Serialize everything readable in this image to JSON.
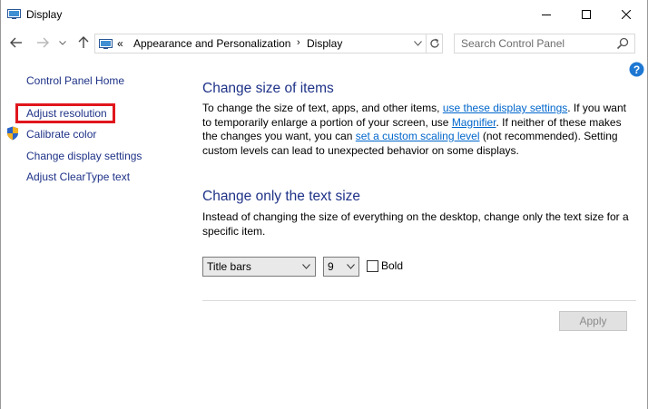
{
  "window": {
    "title": "Display",
    "controls": [
      "minimize",
      "maximize",
      "close"
    ]
  },
  "address_bar": {
    "prefix": "«",
    "breadcrumbs": [
      "Appearance and Personalization",
      "Display"
    ],
    "separator": "›"
  },
  "search": {
    "placeholder": "Search Control Panel"
  },
  "sidebar": {
    "home_link": "Control Panel Home",
    "links": [
      {
        "label": "Adjust resolution",
        "highlighted": true
      },
      {
        "label": "Calibrate color",
        "icon": "shield-icon"
      },
      {
        "label": "Change display settings"
      },
      {
        "label": "Adjust ClearType text"
      }
    ]
  },
  "section1": {
    "heading": "Change size of items",
    "text_1": "To change the size of text, apps, and other items, ",
    "link_1": "use these display settings",
    "text_2": ".  If you want to temporarily enlarge a portion of your screen, use ",
    "link_2": "Magnifier",
    "text_3": ".  If neither of these makes the changes you want, you can ",
    "link_3": "set a custom scaling level",
    "text_4": " (not recommended).  Setting custom levels can lead to unexpected behavior on some displays."
  },
  "section2": {
    "heading": "Change only the text size",
    "description": "Instead of changing the size of everything on the desktop, change only the text size for a specific item.",
    "item_select": "Title bars",
    "size_select": "9",
    "bold_label": "Bold",
    "bold_checked": false
  },
  "apply_label": "Apply",
  "colors": {
    "link": "#0066cc",
    "nav_text": "#1e3287",
    "highlight": "#e0161c",
    "help": "#1e78d2"
  }
}
